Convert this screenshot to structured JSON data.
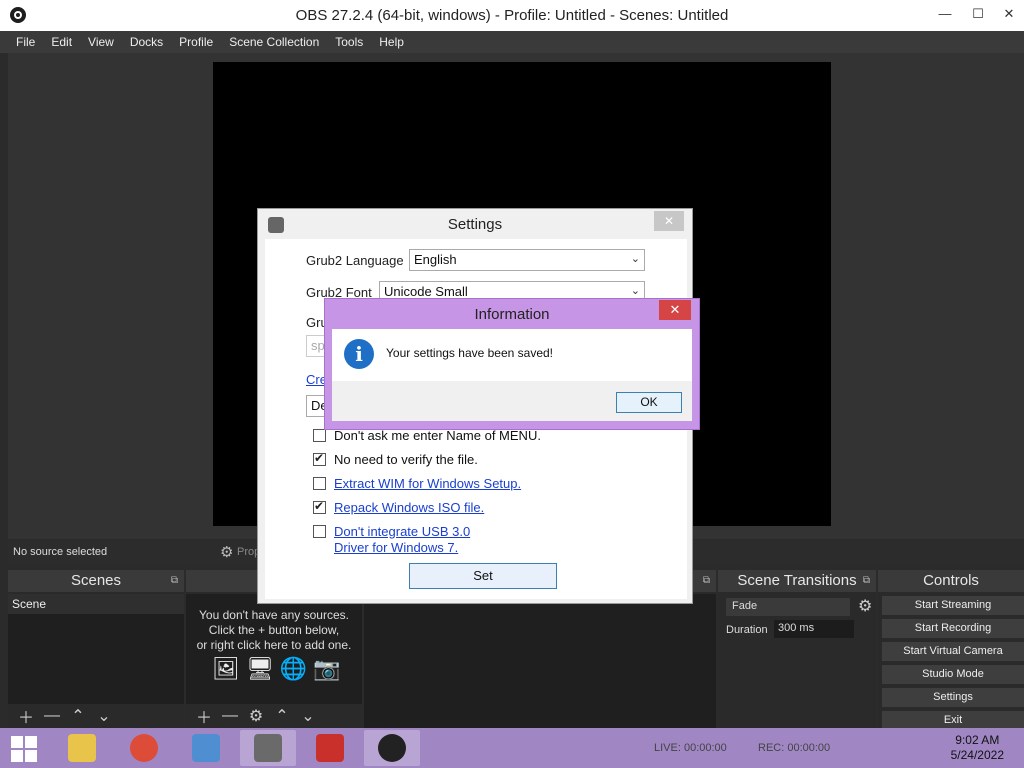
{
  "window": {
    "title": "OBS 27.2.4 (64-bit, windows) - Profile: Untitled - Scenes: Untitled",
    "minimize": "—",
    "maximize": "☐",
    "close": "✕"
  },
  "menu": [
    "File",
    "Edit",
    "View",
    "Docks",
    "Profile",
    "Scene Collection",
    "Tools",
    "Help"
  ],
  "source_bar": {
    "no_source": "No source selected",
    "properties": "Prop"
  },
  "docks": {
    "scenes": {
      "title": "Scenes",
      "items": [
        "Scene"
      ]
    },
    "sources": {
      "title": "So",
      "empty_lines": [
        "You don't have any sources.",
        "Click the + button below,",
        "or right click here to add one."
      ]
    },
    "transitions": {
      "title": "Scene Transitions",
      "selected": "Fade",
      "duration_label": "Duration",
      "duration_value": "300 ms"
    },
    "controls": {
      "title": "Controls",
      "buttons": [
        "Start Streaming",
        "Start Recording",
        "Start Virtual Camera",
        "Studio Mode",
        "Settings",
        "Exit"
      ]
    }
  },
  "settings_dialog": {
    "title": "Settings",
    "close": "✕",
    "language_label": "Grub2 Language",
    "language_value": "English",
    "font_label": "Grub2 Font",
    "font_value": "Unicode Small",
    "partial_label": "Gru",
    "partial_input": "sp",
    "partial_link": "Cre",
    "partial_button": "De",
    "checks": [
      {
        "label": "Don't ask me enter Name of MENU.",
        "checked": false,
        "link": false
      },
      {
        "label": "No need to verify the file.",
        "checked": true,
        "link": false
      },
      {
        "label": "Extract WIM for Windows Setup.",
        "checked": false,
        "link": true
      },
      {
        "label": "Repack Windows ISO file.",
        "checked": true,
        "link": true
      },
      {
        "label": "Don't integrate USB 3.0",
        "label2": "Driver for Windows 7.",
        "checked": false,
        "link": true
      }
    ],
    "set_button": "Set"
  },
  "info_dialog": {
    "title": "Information",
    "close": "✕",
    "icon": "i",
    "message": "Your settings have been saved!",
    "ok": "OK"
  },
  "taskbar": {
    "live": "LIVE: 00:00:00",
    "rec": "REC: 00:00:00",
    "clock_time": "9:02 AM",
    "clock_date": "5/24/2022"
  },
  "icons": {
    "obs": "obs-icon",
    "gear": "gear-icon",
    "add": "plus-icon",
    "remove": "minus-icon",
    "up": "chevron-up-icon",
    "down": "chevron-down-icon"
  },
  "colors": {
    "taskbar": "#a087c4",
    "info_frame": "#c795e5",
    "close_red": "#d64545",
    "link": "#1a3fcf"
  }
}
